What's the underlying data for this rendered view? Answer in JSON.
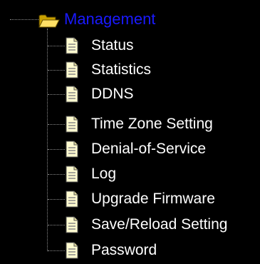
{
  "tree": {
    "folder": {
      "label": "Management",
      "icon": "open-folder-icon",
      "color": "#1a1aff"
    },
    "items": [
      {
        "label": "Status",
        "icon": "document-icon"
      },
      {
        "label": "Statistics",
        "icon": "document-icon"
      },
      {
        "label": "DDNS",
        "icon": "document-icon"
      },
      {
        "label": "Time Zone Setting",
        "icon": "document-icon"
      },
      {
        "label": "Denial-of-Service",
        "icon": "document-icon"
      },
      {
        "label": "Log",
        "icon": "document-icon"
      },
      {
        "label": "Upgrade Firmware",
        "icon": "document-icon"
      },
      {
        "label": "Save/Reload Setting",
        "icon": "document-icon"
      },
      {
        "label": "Password",
        "icon": "document-icon"
      }
    ]
  }
}
